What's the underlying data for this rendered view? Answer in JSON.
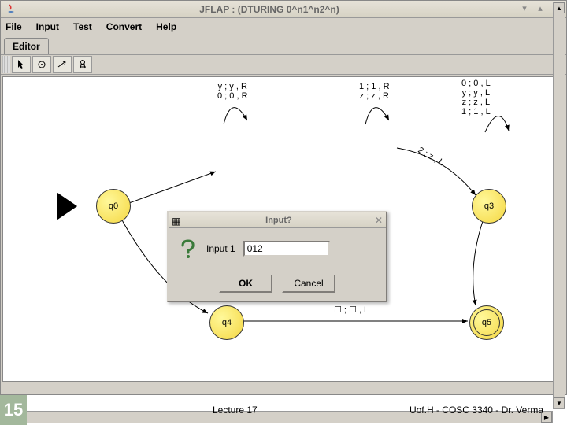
{
  "window": {
    "title": "JFLAP : (DTURING 0^n1^n2^n)"
  },
  "menu": {
    "file": "File",
    "input": "Input",
    "test": "Test",
    "convert": "Convert",
    "help": "Help"
  },
  "tab": {
    "editor": "Editor"
  },
  "states": {
    "q0": "q0",
    "q3": "q3",
    "q4": "q4",
    "q5": "q5"
  },
  "transitions": {
    "loop1": "y ; y , R\n0 ; 0 , R",
    "loop2": "1 ; 1 , R\nz ; z , R",
    "q3labels": "0 ; 0 , L\ny ; y , L\nz ; z , L\n1 ; 1 , L",
    "edge_to_q3": "2 ; z , L",
    "q4_q5": "☐ ; ☐ , L"
  },
  "dialog": {
    "title": "Input?",
    "label": "Input 1",
    "value": "012",
    "ok": "OK",
    "cancel": "Cancel"
  },
  "slide": {
    "num": "15",
    "mid": "Lecture 17",
    "right": "Uof.H - COSC 3340 - Dr. Verma"
  }
}
